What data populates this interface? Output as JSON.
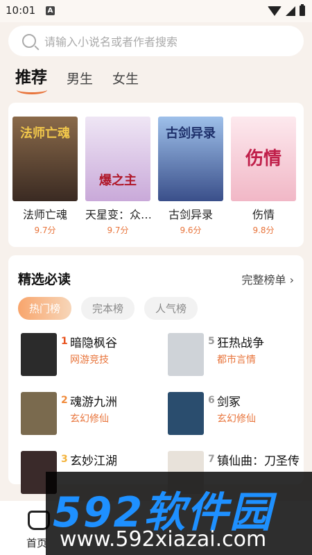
{
  "status": {
    "time": "10:01",
    "notif_icon": "A"
  },
  "search": {
    "placeholder": "请输入小说名或者作者搜索"
  },
  "tabs": [
    {
      "label": "推荐",
      "active": true
    },
    {
      "label": "男生"
    },
    {
      "label": "女生"
    }
  ],
  "recommend": {
    "books": [
      {
        "title": "法师亡魂",
        "score": "9.7分",
        "cover_text": "法师亡魂",
        "cover_color": "#5b4a3c"
      },
      {
        "title": "天星变：众…",
        "score": "9.7分",
        "cover_text": "爆之主",
        "cover_color": "#d9c9e6"
      },
      {
        "title": "古剑异录",
        "score": "9.6分",
        "cover_text": "古剑异录",
        "cover_color": "#5a7fb8"
      },
      {
        "title": "伤情",
        "score": "9.8分",
        "cover_text": "伤情",
        "cover_color": "#f6d4dc"
      }
    ]
  },
  "featured": {
    "title": "精选必读",
    "more": "完整榜单 ›",
    "chips": [
      {
        "label": "热门榜",
        "active": true
      },
      {
        "label": "完本榜"
      },
      {
        "label": "人气榜"
      }
    ],
    "left": [
      {
        "rank": "1",
        "name": "暗隐枫谷",
        "category": "网游竞技",
        "cover_color": "#2b2b2b",
        "rank_color": "#e8531f"
      },
      {
        "rank": "2",
        "name": "魂游九洲",
        "category": "玄幻修仙",
        "cover_color": "#7a6a4e",
        "rank_color": "#f08a3a"
      },
      {
        "rank": "3",
        "name": "玄妙江湖",
        "category": "",
        "cover_color": "#3a2a2a",
        "rank_color": "#f3b23a"
      }
    ],
    "right": [
      {
        "rank": "5",
        "name": "狂热战争",
        "category": "都市言情",
        "cover_color": "#cfd3d8",
        "rank_color": "#999999"
      },
      {
        "rank": "6",
        "name": "剑冢",
        "category": "玄幻修仙",
        "cover_color": "#2a4d6e",
        "rank_color": "#999999"
      },
      {
        "rank": "7",
        "name": "镇仙曲：刀圣传",
        "category": "",
        "cover_color": "#e8e2da",
        "rank_color": "#999999"
      }
    ]
  },
  "bottom_nav": {
    "home_label": "首页"
  },
  "watermark": {
    "logo": "592软件园",
    "url": "www.592xiazai.com"
  }
}
